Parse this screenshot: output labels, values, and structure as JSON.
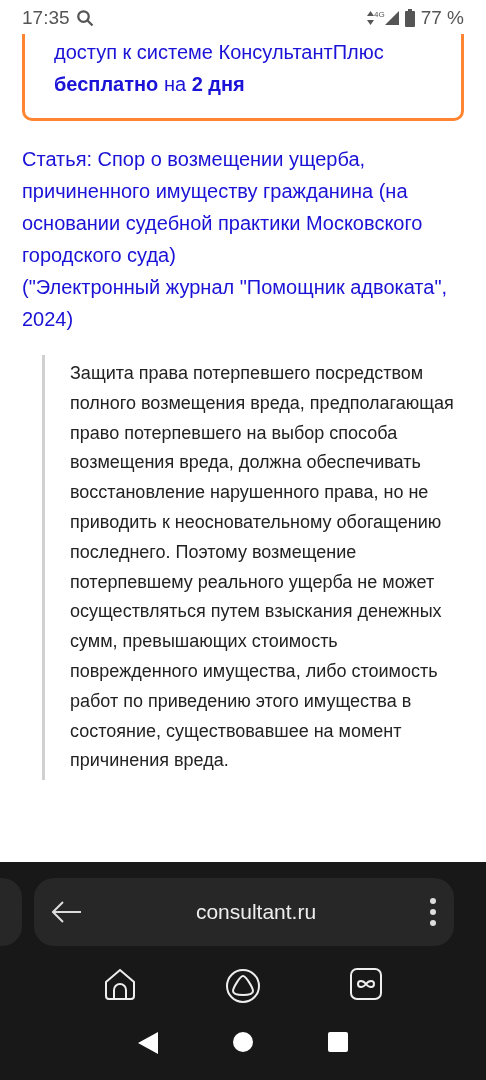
{
  "status_bar": {
    "time": "17:35",
    "network": "4G",
    "battery": "77 %"
  },
  "promo": {
    "text": "доступ к системе КонсультантПлюс **бесплатно** на **2 дня**"
  },
  "article_link": {
    "title": "Статья: Спор о возмещении ущерба, причиненного имуществу гражданина (на основании судебной практики Московского городского суда)",
    "source": "(\"Электронный журнал \"Помощник адвоката\", 2024)"
  },
  "quote": "Защита права потерпевшего посредством полного возмещения вреда, предполагающая право потерпевшего на выбор способа возмещения вреда, должна обеспечивать восстановление нарушенного права, но не приводить к неосновательному обогащению последнего. Поэтому возмещение потерпевшему реального ущерба не может осуществляться путем взыскания денежных сумм, превышающих стоимость поврежденного имущества, либо стоимость работ по приведению этого имущества в состояние, существовавшее на момент причинения вреда.",
  "browser": {
    "address": "consultant.ru"
  }
}
